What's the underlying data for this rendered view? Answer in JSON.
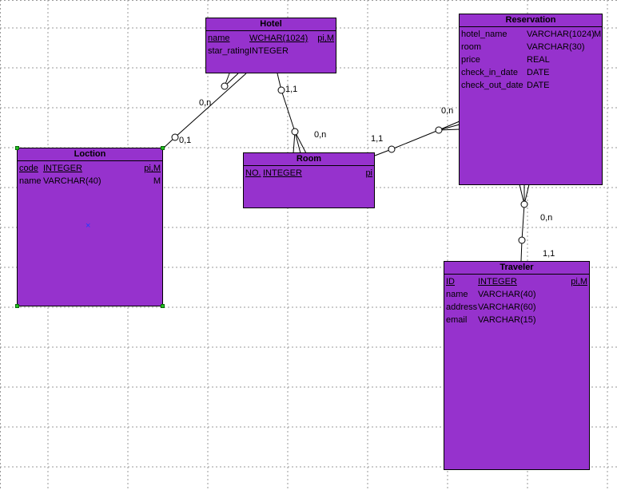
{
  "entities": {
    "hotel": {
      "name": "Hotel",
      "attributes": [
        {
          "name": "name",
          "type": "WCHAR(1024)",
          "flags": "pi,M",
          "key": true
        },
        {
          "name": "star_rating",
          "type": "INTEGER",
          "flags": "",
          "key": false
        }
      ]
    },
    "location": {
      "name": "Loction",
      "attributes": [
        {
          "name": "code",
          "type": "INTEGER",
          "flags": "pi,M",
          "key": true
        },
        {
          "name": "name",
          "type": "VARCHAR(40)",
          "flags": "M",
          "key": false
        }
      ]
    },
    "room": {
      "name": "Room",
      "attributes": [
        {
          "name": "NO.",
          "type": "INTEGER",
          "flags": "pi",
          "key": true
        }
      ]
    },
    "reservation": {
      "name": "Reservation",
      "attributes": [
        {
          "name": "hotel_name",
          "type": "VARCHAR(1024)",
          "flags": "M",
          "key": false
        },
        {
          "name": "room",
          "type": "VARCHAR(30)",
          "flags": "",
          "key": false
        },
        {
          "name": "price",
          "type": "REAL",
          "flags": "",
          "key": false
        },
        {
          "name": "check_in_date",
          "type": "DATE",
          "flags": "",
          "key": false
        },
        {
          "name": "check_out_date",
          "type": "DATE",
          "flags": "",
          "key": false
        }
      ]
    },
    "traveler": {
      "name": "Traveler",
      "attributes": [
        {
          "name": "ID",
          "type": "INTEGER",
          "flags": "pi,M",
          "key": true
        },
        {
          "name": "name",
          "type": "VARCHAR(40)",
          "flags": "",
          "key": false
        },
        {
          "name": "address",
          "type": "VARCHAR(60)",
          "flags": "",
          "key": false
        },
        {
          "name": "email",
          "type": "VARCHAR(15)",
          "flags": "",
          "key": false
        }
      ]
    }
  },
  "relationships": {
    "hotel_location": {
      "hotel_card": "0,n",
      "location_card": "0,1"
    },
    "hotel_room": {
      "hotel_card": "1,1",
      "room_card": "0,n"
    },
    "room_reservation": {
      "room_card": "1,1",
      "reservation_card": "0,n"
    },
    "reservation_traveler": {
      "reservation_card": "0,n",
      "traveler_card": "1,1"
    }
  },
  "colors": {
    "entity_fill": "#9632cd",
    "border": "#000000",
    "selection_handle": "#22c022",
    "center_mark": "#1e3cff",
    "grid": "#9a9a9a"
  },
  "selection": {
    "entity": "location",
    "center_mark": "×"
  }
}
